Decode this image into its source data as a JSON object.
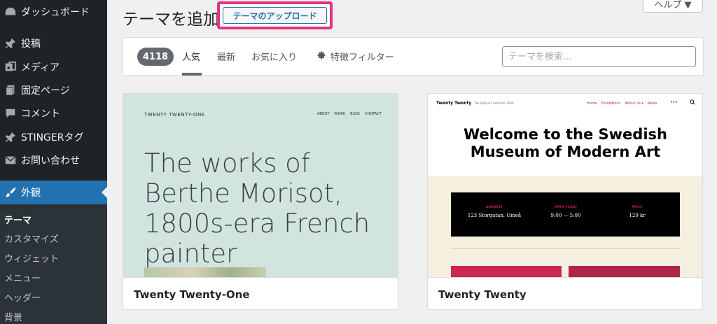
{
  "sidebar": {
    "items": [
      {
        "label": "ダッシュボード",
        "icon": "dashboard-icon"
      },
      {
        "label": "投稿",
        "icon": "pin-icon"
      },
      {
        "label": "メディア",
        "icon": "media-icon"
      },
      {
        "label": "固定ページ",
        "icon": "page-icon"
      },
      {
        "label": "コメント",
        "icon": "comment-icon"
      },
      {
        "label": "STINGERタグ",
        "icon": "pin-icon"
      },
      {
        "label": "お問い合わせ",
        "icon": "mail-icon"
      },
      {
        "label": "外観",
        "icon": "brush-icon"
      }
    ],
    "submenu": [
      "テーマ",
      "カスタマイズ",
      "ウィジェット",
      "メニュー",
      "ヘッダー",
      "背景"
    ]
  },
  "header": {
    "title": "テーマを追加",
    "upload_label": "テーマのアップロード",
    "help_label": "ヘルプ ▼"
  },
  "filter": {
    "count": "4118",
    "tabs": [
      "人気",
      "最新",
      "お気に入り"
    ],
    "feature_filter": "特徴フィルター",
    "search_placeholder": "テーマを検索..."
  },
  "themes": [
    {
      "name": "Twenty Twenty-One",
      "preview": {
        "site_title": "TWENTY TWENTY-ONE",
        "nav": [
          "ABOUT",
          "WORK",
          "BLOG",
          "CONTACT"
        ],
        "headline": "The works of Berthe Morisot, 1800s-era French painter"
      }
    },
    {
      "name": "Twenty Twenty",
      "preview": {
        "site_title": "Twenty Twenty",
        "tagline": "The Default Theme for 2020",
        "nav": [
          "Home",
          "Exhibitions",
          "About Us ▾",
          "News"
        ],
        "menu_label": "•••",
        "headline": "Welcome to the Swedish Museum of Modern Art",
        "info": [
          {
            "label": "ADDRESS",
            "value": "123 Storgatan, Umeå"
          },
          {
            "label": "OPEN TODAY",
            "value": "9:00 — 5:00"
          },
          {
            "label": "PRICE",
            "value": "129 kr"
          }
        ]
      }
    }
  ],
  "colors": {
    "sidebar_bg": "#1d2327",
    "accent": "#2271b1",
    "highlight": "#e6337a",
    "tt_accent": "#cd2653"
  }
}
